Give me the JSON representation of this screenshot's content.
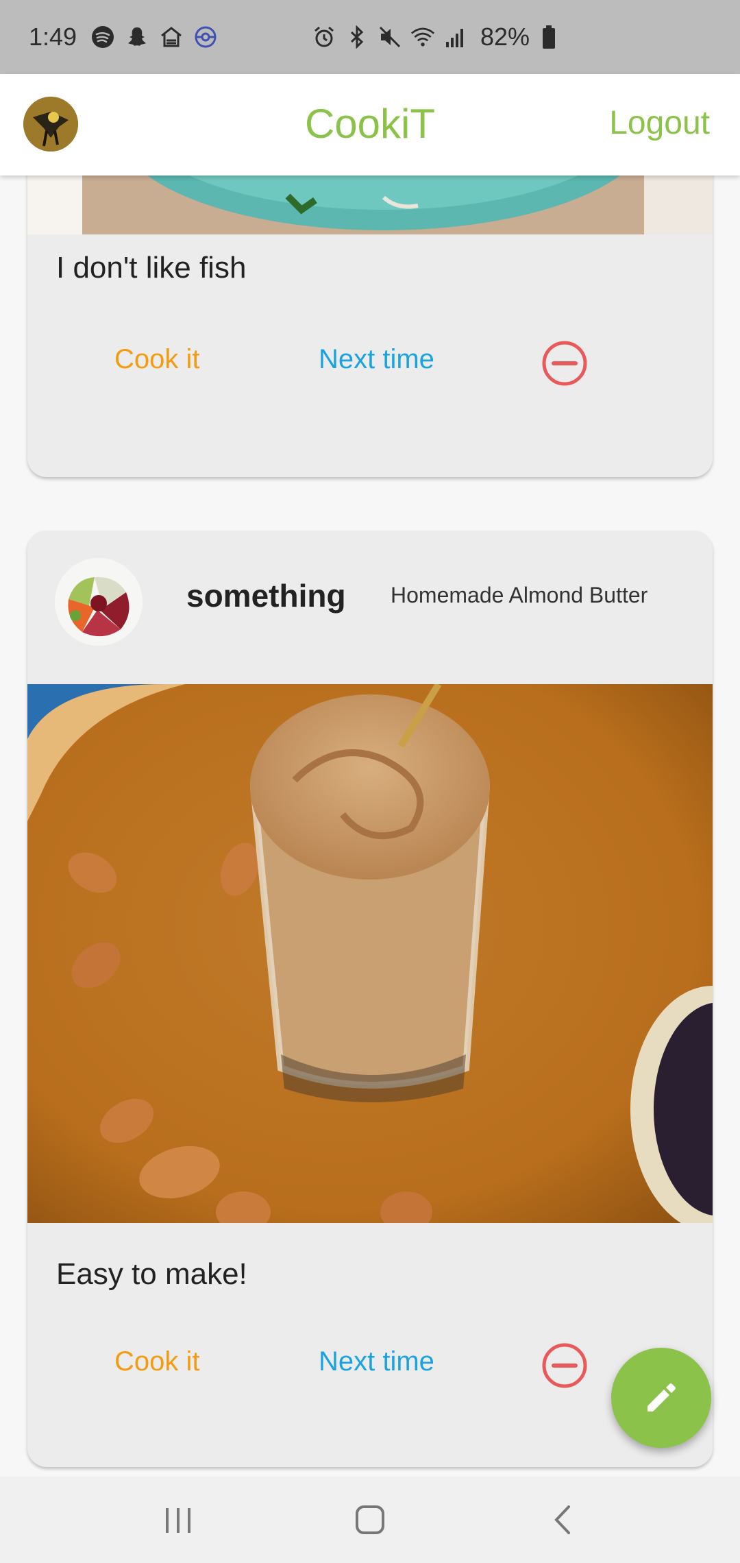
{
  "status_bar": {
    "time": "1:49",
    "left_icons": [
      "spotify-icon",
      "snapchat-icon",
      "home-app-icon",
      "pokemon-go-icon"
    ],
    "right_icons": [
      "alarm-icon",
      "bluetooth-icon",
      "mute-icon",
      "wifi-icon",
      "signal-icon"
    ],
    "battery_percent": "82%"
  },
  "app_bar": {
    "title": "CookiT",
    "logout_label": "Logout",
    "accent_color": "#8bc34a"
  },
  "posts": [
    {
      "caption": "I don't like fish",
      "cook_label": "Cook it",
      "next_label": "Next time"
    },
    {
      "author": "something",
      "recipe": "Homemade Almond Butter",
      "caption": "Easy to make!",
      "cook_label": "Cook it",
      "next_label": "Next time"
    }
  ],
  "colors": {
    "cook": "#f39c12",
    "next": "#1aa3e0",
    "remove": "#e85a5a",
    "card": "#ececec"
  },
  "fab": {
    "icon": "pencil-icon"
  },
  "nav_bar": {
    "icons": [
      "recents-icon",
      "home-icon",
      "back-icon"
    ]
  }
}
